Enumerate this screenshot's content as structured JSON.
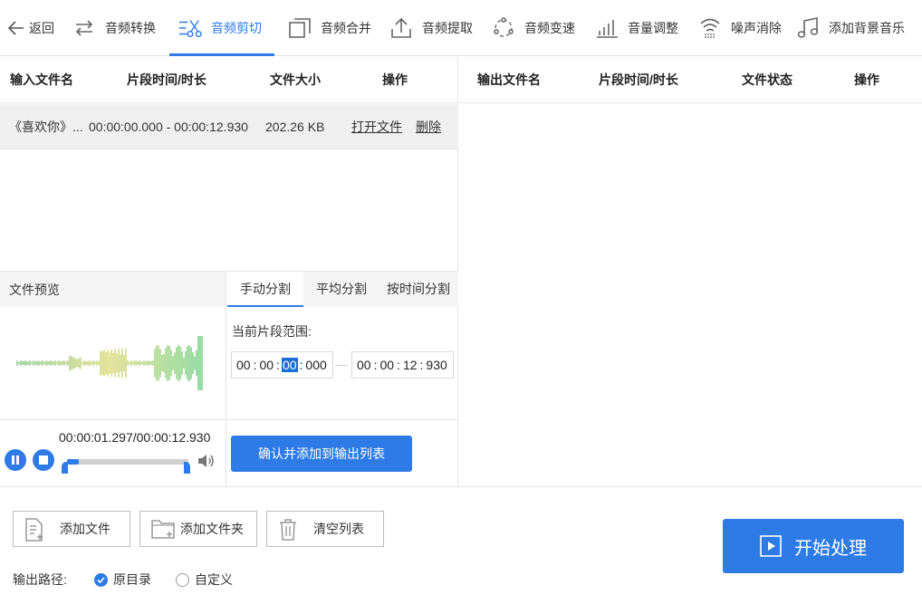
{
  "toolbar": {
    "back": "返回",
    "items": [
      {
        "label": "音频转换",
        "icon": "convert-icon"
      },
      {
        "label": "音频剪切",
        "icon": "scissors-icon",
        "active": true
      },
      {
        "label": "音频合并",
        "icon": "merge-icon"
      },
      {
        "label": "音频提取",
        "icon": "extract-icon"
      },
      {
        "label": "音频变速",
        "icon": "speed-icon"
      },
      {
        "label": "音量调整",
        "icon": "volume-bars-icon"
      },
      {
        "label": "噪声消除",
        "icon": "noise-icon"
      },
      {
        "label": "添加背景音乐",
        "icon": "music-note-icon"
      }
    ]
  },
  "input_table": {
    "headers": [
      "输入文件名",
      "片段时间/时长",
      "文件大小",
      "操作"
    ],
    "rows": [
      {
        "name": "《喜欢你》...",
        "range": "00:00:00.000 - 00:00:12.930",
        "size": "202.26 KB",
        "open": "打开文件",
        "delete": "删除"
      }
    ]
  },
  "output_table": {
    "headers": [
      "输出文件名",
      "片段时间/时长",
      "文件状态",
      "操作"
    ],
    "rows": []
  },
  "preview": {
    "title": "文件预览",
    "time": "00:00:01.297/00:00:12.930",
    "progress": 0.1,
    "colors": {
      "waveform_start": "#4caf50",
      "waveform_mid": "#c8c83a",
      "waveform_end": "#2eb84a"
    }
  },
  "split": {
    "tabs": [
      "手动分割",
      "平均分割",
      "按时间分割"
    ],
    "active_tab": 0,
    "range_label": "当前片段范围:",
    "start": {
      "h": "00",
      "m": "00",
      "s": "00",
      "ms": "000"
    },
    "end": {
      "h": "00",
      "m": "00",
      "s": "12",
      "ms": "930"
    },
    "confirm": "确认并添加到输出列表"
  },
  "bottom": {
    "add_file": "添加文件",
    "add_folder": "添加文件夹",
    "clear": "清空列表",
    "output_path_label": "输出路径:",
    "options": [
      {
        "label": "原目录",
        "checked": true
      },
      {
        "label": "自定义",
        "checked": false
      }
    ],
    "start": "开始处理"
  },
  "accent": "#2f7be6"
}
